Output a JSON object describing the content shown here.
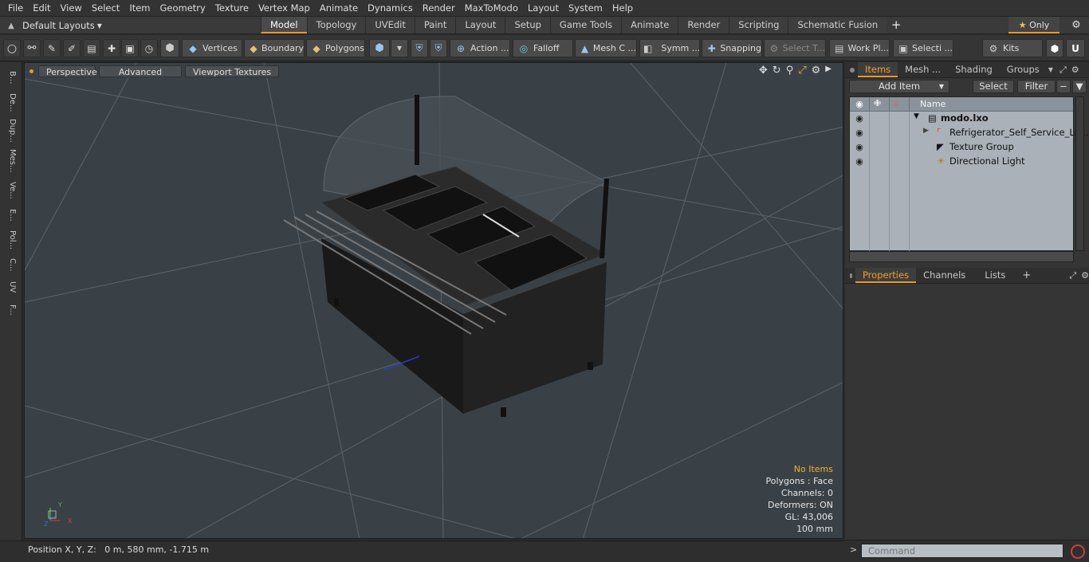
{
  "menu": [
    "File",
    "Edit",
    "View",
    "Select",
    "Item",
    "Geometry",
    "Texture",
    "Vertex Map",
    "Animate",
    "Dynamics",
    "Render",
    "MaxToModo",
    "Layout",
    "System",
    "Help"
  ],
  "layouts_label": "Default Layouts",
  "tabs": [
    "Model",
    "Topology",
    "UVEdit",
    "Paint",
    "Layout",
    "Setup",
    "Game Tools",
    "Animate",
    "Render",
    "Scripting",
    "Schematic Fusion"
  ],
  "active_tab": "Model",
  "only_label": "Only",
  "toolbar": {
    "vertices": "Vertices",
    "boundary": "Boundary",
    "polygons": "Polygons",
    "action": "Action ...",
    "falloff": "Falloff",
    "mesh_c": "Mesh C ...",
    "symm": "Symm ...",
    "snapping": "Snapping",
    "select_t": "Select T...",
    "work_pl": "Work Pl...",
    "selecti": "Selecti ...",
    "kits": "Kits"
  },
  "left_strip": [
    "B...",
    "De...",
    "Dup...",
    "Mes...",
    "Ve...",
    "E...",
    "Pol...",
    "C...",
    "UV",
    "F..."
  ],
  "viewport": {
    "perspective": "Perspective",
    "advanced": "Advanced",
    "textures": "Viewport Textures",
    "stats": {
      "no_items": "No Items",
      "polygons": "Polygons : Face",
      "channels": "Channels: 0",
      "deformers": "Deformers: ON",
      "gl": "GL: 43,006",
      "scale": "100 mm"
    },
    "axes": {
      "x": "X",
      "y": "Y",
      "z": "Z"
    }
  },
  "status": "Position X, Y, Z:   0 m, 580 mm, -1.715 m",
  "items_panel": {
    "tabs": [
      "Items",
      "Mesh ...",
      "Shading",
      "Groups"
    ],
    "add_item": "Add Item",
    "select": "Select",
    "filter": "Filter",
    "col_name": "Name",
    "rows": [
      {
        "name": "modo.lxo"
      },
      {
        "name": "Refrigerator_Self_Service_Li ..."
      },
      {
        "name": "Texture Group"
      },
      {
        "name": "Directional Light"
      }
    ]
  },
  "props_panel": {
    "tabs": [
      "Properties",
      "Channels",
      "Lists"
    ]
  },
  "command_placeholder": "Command"
}
